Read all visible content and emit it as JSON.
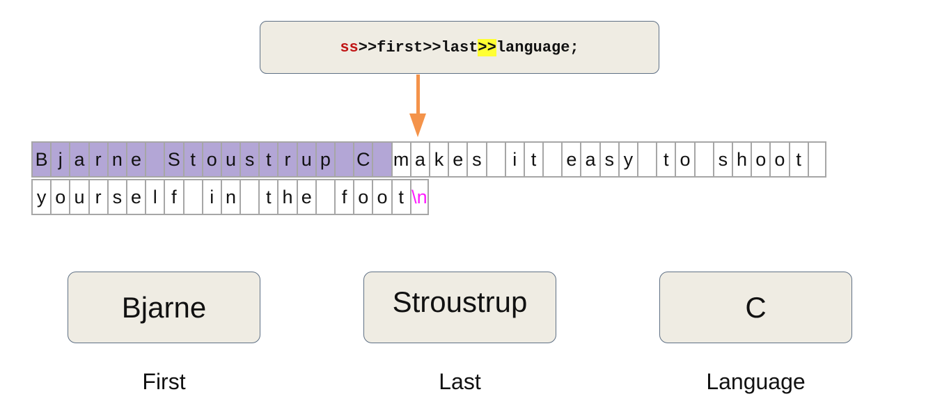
{
  "code": {
    "stream": "ss",
    "op1": ">>",
    "var1": "first",
    "op2": ">>",
    "var2": "last",
    "op3_highlighted": ">>",
    "var3": "language;"
  },
  "buffer": {
    "row1": [
      "B",
      "j",
      "a",
      "r",
      "n",
      "e",
      " ",
      "S",
      "t",
      "o",
      "u",
      "s",
      "t",
      "r",
      "u",
      "p",
      " ",
      "C",
      " ",
      "m",
      "a",
      "k",
      "e",
      "s",
      " ",
      "i",
      "t",
      " ",
      "e",
      "a",
      "s",
      "y",
      " ",
      "t",
      "o",
      " ",
      "s",
      "h",
      "o",
      "o",
      "t",
      " "
    ],
    "row2": [
      "y",
      "o",
      "u",
      "r",
      "s",
      "e",
      "l",
      "f",
      " ",
      "i",
      "n",
      " ",
      "t",
      "h",
      "e",
      " ",
      "f",
      "o",
      "o",
      "t",
      "\\n"
    ],
    "consumed_count_row1": 19
  },
  "variables": [
    {
      "value": "Bjarne",
      "label": "First"
    },
    {
      "value": "Stroustrup",
      "label": "Last"
    },
    {
      "value": "C",
      "label": "Language"
    }
  ],
  "colors": {
    "consumed_cell": "#b3a6d6",
    "arrow": "#f4934a",
    "highlight": "#ffff33",
    "stream_name": "#c01515",
    "newline": "#ff1aff"
  }
}
